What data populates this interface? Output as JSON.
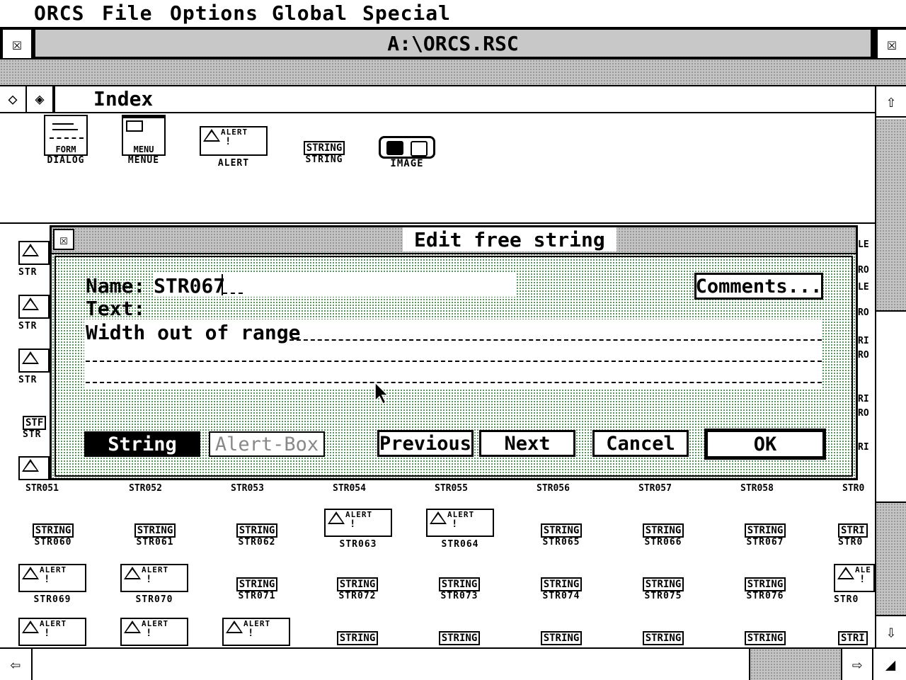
{
  "menubar": {
    "items": [
      "ORCS",
      "File",
      "Options",
      "Global",
      "Special"
    ]
  },
  "window": {
    "title": "A:\\ORCS.RSC",
    "pane_title": "Index"
  },
  "index_types": [
    {
      "caption": "DIALOG",
      "icon_label": "FORM"
    },
    {
      "caption": "MENUE",
      "icon_label": "MENU"
    },
    {
      "caption": "ALERT",
      "icon_label": "ALERT"
    },
    {
      "caption": "STRING",
      "icon_label": "STRING"
    },
    {
      "caption": "IMAGE"
    }
  ],
  "lower_rows": [
    {
      "labels": [
        "STR051",
        "STR052",
        "STR053",
        "STR054",
        "STR055",
        "STR056",
        "STR057",
        "STR058",
        "STR0"
      ]
    },
    {
      "labels": [
        "STR060",
        "STR061",
        "STR062",
        "STR063",
        "STR064",
        "STR065",
        "STR066",
        "STR067",
        "STR0"
      ],
      "kinds": [
        "S",
        "S",
        "S",
        "A",
        "A",
        "S",
        "S",
        "S",
        "S"
      ]
    },
    {
      "labels": [
        "STR069",
        "STR070",
        "STR071",
        "STR072",
        "STR073",
        "STR074",
        "STR075",
        "STR076",
        "STR0"
      ],
      "kinds": [
        "A",
        "A",
        "S",
        "S",
        "S",
        "S",
        "S",
        "S",
        "A"
      ]
    },
    {
      "kinds": [
        "A",
        "A",
        "A",
        "S",
        "S",
        "S",
        "S",
        "S",
        "S"
      ]
    }
  ],
  "left_column_labels": [
    "STR",
    "STR",
    "STR",
    "STR"
  ],
  "right_column_labels": [
    "LE",
    "RO",
    "LE",
    "RO",
    "RI",
    "RO",
    "RI",
    "RO",
    "RI"
  ],
  "icon_text": {
    "string": "STRING",
    "alert": "ALERT",
    "string_partial": "STRI",
    "alert_partial": "ALE",
    "str_short": "STF"
  },
  "dialog": {
    "title": "Edit free string",
    "name_label": "Name:",
    "name_value": "STR067",
    "text_label": "Text:",
    "text_line1": "Width out of range",
    "comments_button": "Comments...",
    "type_string": "String",
    "type_alert": "Alert-Box",
    "previous_button": "Previous",
    "next_button": "Next",
    "cancel_button": "Cancel",
    "ok_button": "OK"
  }
}
